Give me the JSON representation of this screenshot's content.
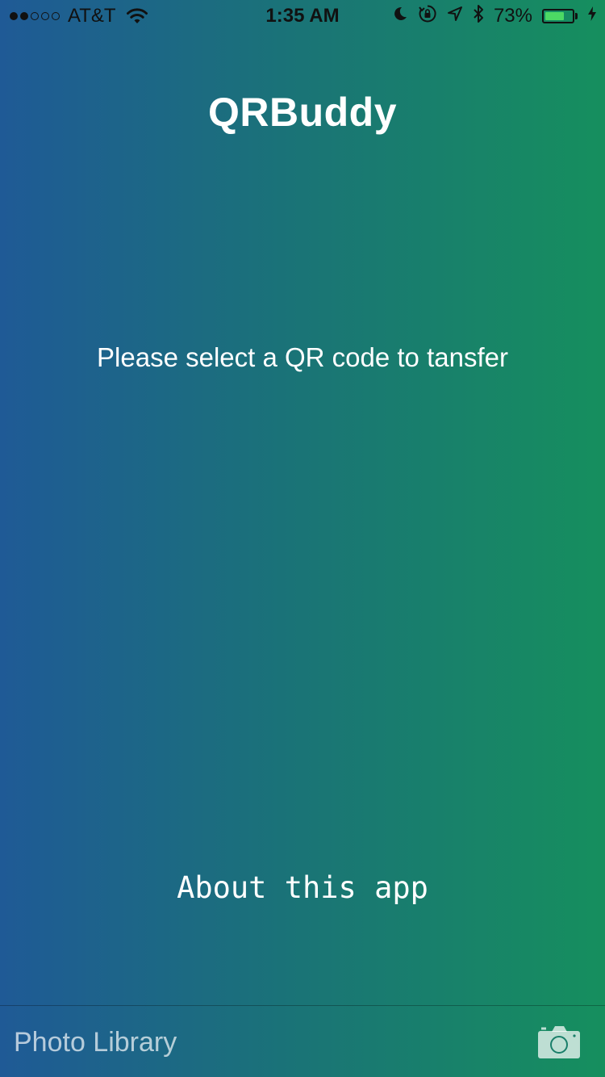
{
  "status_bar": {
    "signal_filled": 2,
    "signal_total": 5,
    "carrier": "AT&T",
    "time": "1:35 AM",
    "battery_percent": "73%",
    "battery_level": 0.73,
    "icons": [
      "wifi-icon",
      "moon-icon",
      "orientation-lock-icon",
      "location-arrow-icon",
      "bluetooth-icon",
      "battery-icon",
      "charging-bolt-icon"
    ]
  },
  "header": {
    "title": "QRBuddy"
  },
  "main": {
    "prompt": "Please select a QR code to tansfer",
    "about_link": "About this app"
  },
  "toolbar": {
    "photo_library_label": "Photo Library",
    "camera_icon": "camera-icon"
  },
  "colors": {
    "gradient_left": "#1f5a96",
    "gradient_right": "#168f5e",
    "battery_green": "#4cd964"
  }
}
